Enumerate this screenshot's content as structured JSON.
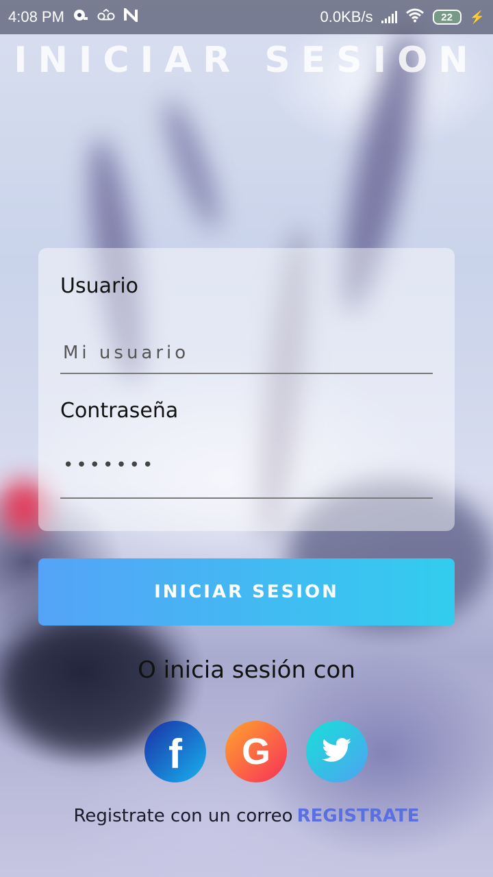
{
  "status_bar": {
    "time": "4:08 PM",
    "network_speed": "0.0KB/s",
    "battery_level": "22",
    "icons": [
      "notification-icon",
      "voicemail-icon",
      "n-app-icon",
      "signal-icon",
      "wifi-icon",
      "battery-icon",
      "charging-icon"
    ]
  },
  "header": {
    "title": "INICIAR SESION"
  },
  "form": {
    "username_label": "Usuario",
    "username_placeholder": "Mi usuario",
    "password_label": "Contraseña",
    "password_value": "•••••••"
  },
  "login_button": {
    "label": "INICIAR  SESION"
  },
  "social": {
    "heading": "O inicia sesión con",
    "providers": [
      "facebook",
      "google",
      "twitter"
    ]
  },
  "footer": {
    "text": "Registrate con un correo",
    "link": "REGISTRATE"
  },
  "colors": {
    "button_start": "#55a3f7",
    "button_end": "#32cdee",
    "link": "#5a6fe0",
    "facebook": "#1a2ea6",
    "google": "#f72f5a",
    "twitter": "#17e0d8"
  }
}
